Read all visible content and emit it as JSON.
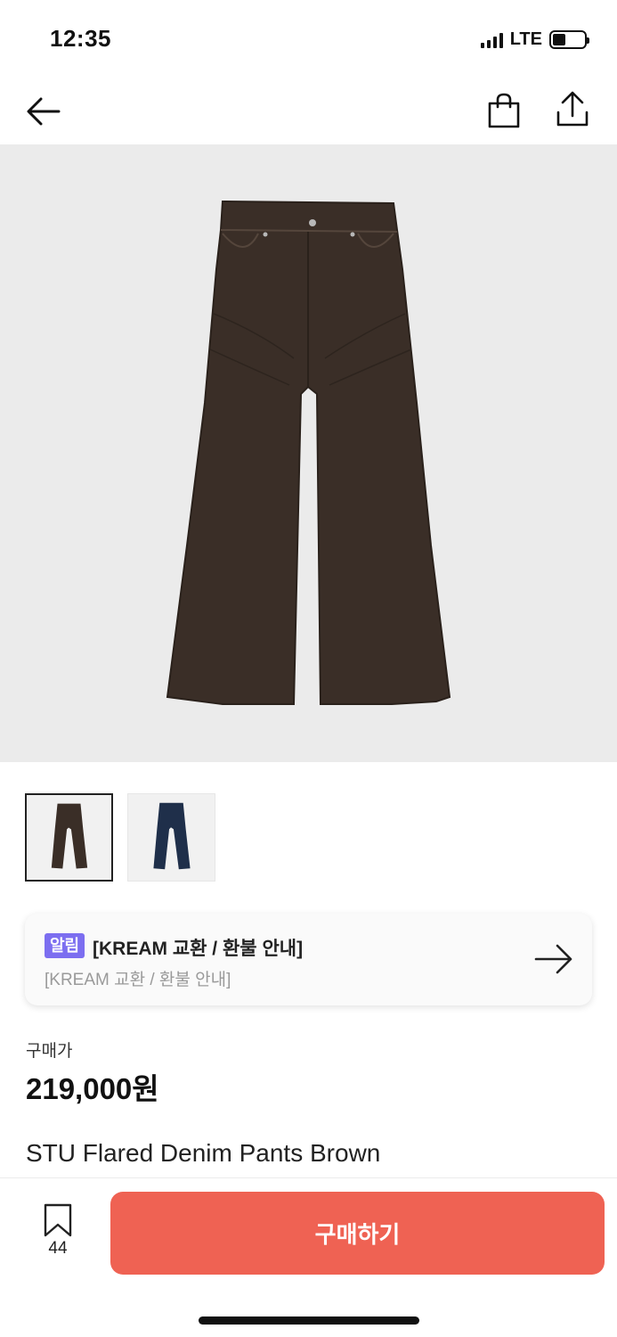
{
  "status_bar": {
    "time": "12:35",
    "network": "LTE",
    "battery_icon": "battery-low-icon"
  },
  "nav": {
    "back_icon": "arrow-left-icon",
    "bag_icon": "shopping-bag-icon",
    "share_icon": "share-icon"
  },
  "product": {
    "images": [
      {
        "color": "#3a2e27",
        "label": "brown"
      },
      {
        "color": "#1f2f4a",
        "label": "navy"
      }
    ],
    "active_image_index": 0
  },
  "notice": {
    "badge": "알림",
    "title": "[KREAM 교환 / 환불 안내]",
    "subtitle": "[KREAM 교환 / 환불 안내]",
    "arrow_icon": "arrow-right-icon"
  },
  "price": {
    "label": "구매가",
    "value": "219,000원"
  },
  "product_name": "STU Flared Denim Pants Brown",
  "bottom_bar": {
    "bookmark_icon": "bookmark-icon",
    "bookmark_count": "44",
    "buy_label": "구매하기",
    "buy_color": "#ef6253"
  }
}
